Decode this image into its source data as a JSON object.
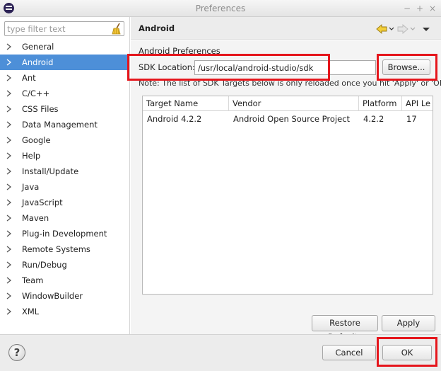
{
  "window": {
    "title": "Preferences",
    "controls": [
      "−",
      "+",
      "×"
    ]
  },
  "sidebar": {
    "filter_placeholder": "type filter text",
    "items": [
      {
        "label": "General"
      },
      {
        "label": "Android",
        "selected": true
      },
      {
        "label": "Ant"
      },
      {
        "label": "C/C++"
      },
      {
        "label": "CSS Files"
      },
      {
        "label": "Data Management"
      },
      {
        "label": "Google"
      },
      {
        "label": "Help"
      },
      {
        "label": "Install/Update"
      },
      {
        "label": "Java"
      },
      {
        "label": "JavaScript"
      },
      {
        "label": "Maven"
      },
      {
        "label": "Plug-in Development"
      },
      {
        "label": "Remote Systems"
      },
      {
        "label": "Run/Debug"
      },
      {
        "label": "Team"
      },
      {
        "label": "WindowBuilder"
      },
      {
        "label": "XML"
      }
    ]
  },
  "page": {
    "title": "Android",
    "section_title": "Android Preferences",
    "sdk_label": "SDK Location:",
    "sdk_value": "/usr/local/android-studio/sdk",
    "browse_label": "Browse...",
    "note": "Note: The list of SDK Targets below is only reloaded once you hit 'Apply' or 'OK'.",
    "table": {
      "columns": [
        "Target Name",
        "Vendor",
        "Platform",
        "API Le"
      ],
      "rows": [
        [
          "Android 4.2.2",
          "Android Open Source Project",
          "4.2.2",
          "17"
        ]
      ]
    },
    "restore_defaults_label": "Restore Defaults",
    "apply_label": "Apply"
  },
  "footer": {
    "help_label": "?",
    "cancel_label": "Cancel",
    "ok_label": "OK"
  },
  "colors": {
    "selection": "#4d8fd8",
    "annotation": "#e5161c"
  }
}
